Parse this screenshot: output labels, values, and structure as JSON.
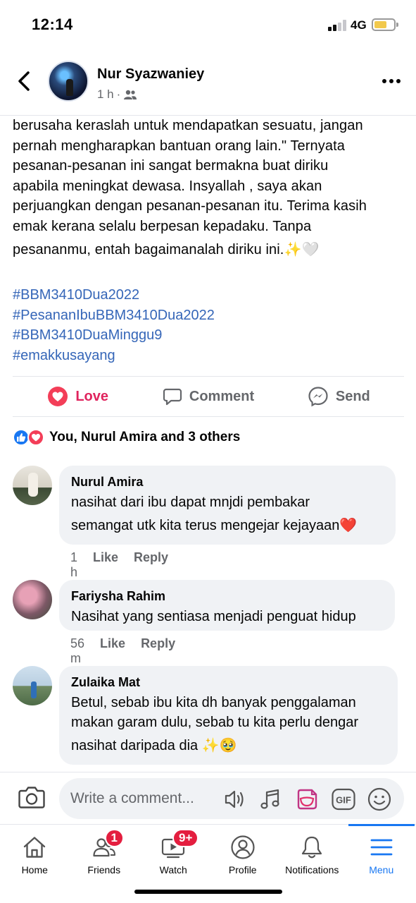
{
  "status_bar": {
    "time": "12:14",
    "network": "4G"
  },
  "header": {
    "poster_name": "Nur Syazwaniey",
    "post_age": "1 h",
    "separator": "·"
  },
  "post": {
    "lines": [
      "berusaha keraslah untuk mendapatkan sesuatu, jangan",
      "pernah mengharapkan bantuan orang lain.\" Ternyata",
      "pesanan-pesanan ini sangat bermakna buat diriku",
      "apabila meningkat dewasa. Insyallah , saya akan",
      "perjuangkan dengan pesanan-pesanan  itu. Terima kasih",
      "emak kerana selalu berpesan kepadaku. Tanpa",
      "pesananmu, entah bagaimanalah diriku ini.✨🤍"
    ],
    "hashtags": [
      "#BBM3410Dua2022",
      "#PesananIbuBBM3410Dua2022",
      "#BBM3410DuaMinggu9",
      "#emakkusayang"
    ]
  },
  "actions": {
    "love": "Love",
    "comment": "Comment",
    "send": "Send"
  },
  "reactions": {
    "summary": "You, Nurul Amira and 3 others"
  },
  "comments": [
    {
      "name": "Nurul Amira",
      "lines": [
        "nasihat dari ibu dapat mnjdi pembakar",
        "semangat utk kita terus mengejar kejayaan❤️"
      ],
      "time": "1 h",
      "like": "Like",
      "reply": "Reply"
    },
    {
      "name": "Fariysha Rahim",
      "lines": [
        "Nasihat yang sentiasa menjadi penguat hidup"
      ],
      "time": "56 m",
      "like": "Like",
      "reply": "Reply"
    },
    {
      "name": "Zulaika Mat",
      "lines": [
        "Betul, sebab ibu kita dh banyak penggalaman",
        "makan garam dulu, sebab tu kita perlu dengar",
        "nasihat daripada dia ✨🥹"
      ]
    }
  ],
  "comment_input": {
    "placeholder": "Write a comment..."
  },
  "tabs": [
    {
      "label": "Home",
      "icon": "home-icon"
    },
    {
      "label": "Friends",
      "icon": "friends-icon",
      "badge": "1"
    },
    {
      "label": "Watch",
      "icon": "watch-icon",
      "badge": "9+"
    },
    {
      "label": "Profile",
      "icon": "profile-icon"
    },
    {
      "label": "Notifications",
      "icon": "bell-icon"
    },
    {
      "label": "Menu",
      "icon": "menu-icon",
      "active": true
    }
  ],
  "colors": {
    "accent": "#1877f2",
    "hashtag": "#3566b8",
    "love": "#e0245e",
    "badge": "#e41e3f",
    "bubble": "#f0f2f5"
  }
}
